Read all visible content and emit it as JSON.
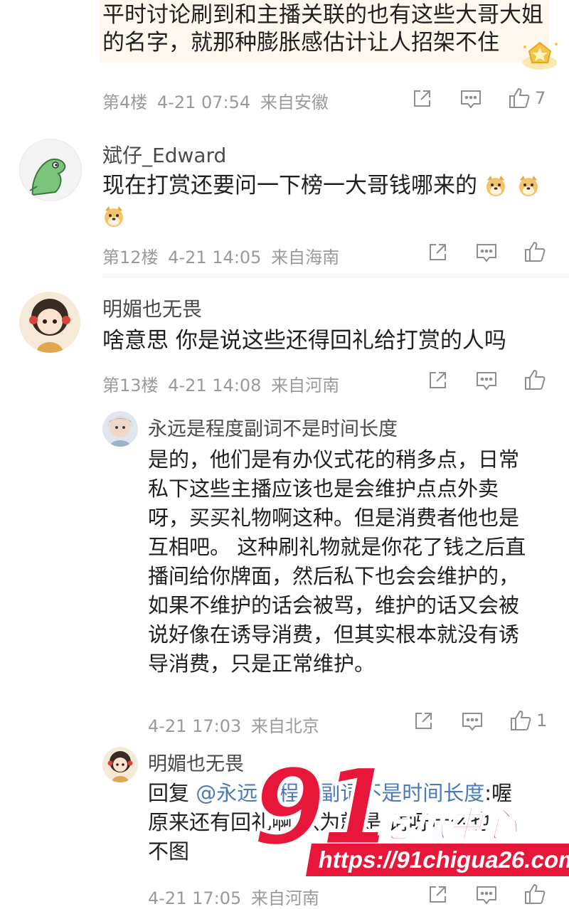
{
  "comments": [
    {
      "text_lines": [
        "平时讨论刷到和主播关联的也有这些大哥大姐",
        "的名字，就那种膨胀感估计让人招架不住"
      ],
      "floor": "第4楼",
      "time": "4-21 07:54",
      "location": "来自安徽",
      "like_count": "7"
    },
    {
      "user": "斌仔_Edward",
      "text_line1": "现在打赏还要问一下榜一大哥钱哪来的",
      "floor": "第12楼",
      "time": "4-21 14:05",
      "location": "来自海南",
      "like_count": ""
    },
    {
      "user": "明媚也无畏",
      "text": "啥意思 你是说这些还得回礼给打赏的人吗",
      "floor": "第13楼",
      "time": "4-21 14:08",
      "location": "来自河南",
      "like_count": ""
    }
  ],
  "replies": [
    {
      "user": "永远是程度副词不是时间长度",
      "text_lines": [
        "是的，他们是有办仪式花的稍多点，日常",
        "私下这些主播应该也是会维护点点外卖",
        "呀，买买礼物啊这种。但是消费者他也是",
        "互相吧。 这种刷礼物就是你花了钱之后直",
        "播间给你牌面，然后私下也会会维护的，",
        "如果不维护的话会被骂，维护的话又会被",
        "说好像在诱导消费，但其实根本就没有诱",
        "导消费，只是正常维护。"
      ],
      "time": "4-21 17:03",
      "location": "来自北京",
      "like_count": "1"
    },
    {
      "user": "明媚也无畏",
      "reply_prefix": "回复",
      "mention": "@永远是程度副词不是时间长度",
      "mention_suffix": ":喔",
      "text_lines": [
        "原来还有回礼啊 以为就是 请呀什么也",
        "不图"
      ],
      "time": "4-21 17:05",
      "location": "来自河南"
    }
  ],
  "watermark": {
    "number": "91",
    "brand": "吃瓜中心",
    "url": "https://91chigua26.com"
  },
  "colors": {
    "accent_red": "#e8173a",
    "mention_blue": "#4a7ab8",
    "meta_gray": "#9a9a9a"
  },
  "icons": [
    "share-icon",
    "comment-icon",
    "like-icon",
    "dog-emoji",
    "gold-badge-icon"
  ]
}
